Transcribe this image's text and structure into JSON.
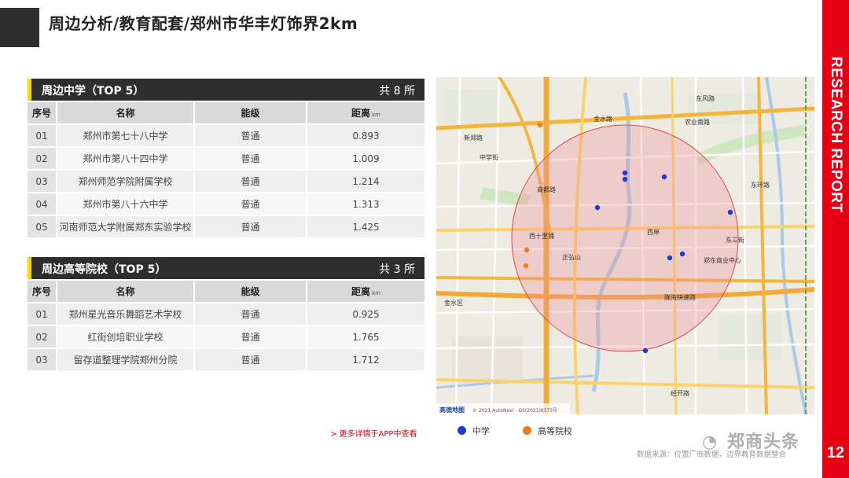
{
  "page": {
    "title": "周边分析/教育配套/郑州市华丰灯饰界2km",
    "side_text": "RESEARCH REPORT",
    "page_number": "12"
  },
  "middle_school": {
    "title": "周边中学（TOP 5）",
    "count": "共 8 所",
    "columns": [
      "序号",
      "名称",
      "能级",
      "距离"
    ],
    "unit": "km",
    "rows": [
      {
        "no": "01",
        "name": "郑州市第七十八中学",
        "level": "普通",
        "distance": "0.893"
      },
      {
        "no": "02",
        "name": "郑州市第八十四中学",
        "level": "普通",
        "distance": "1.009"
      },
      {
        "no": "03",
        "name": "郑州师范学院附属学校",
        "level": "普通",
        "distance": "1.214"
      },
      {
        "no": "04",
        "name": "郑州市第八十六中学",
        "level": "普通",
        "distance": "1.313"
      },
      {
        "no": "05",
        "name": "河南师范大学附属郑东实验学校",
        "level": "普通",
        "distance": "1.425"
      }
    ]
  },
  "college": {
    "title": "周边高等院校（TOP 5）",
    "count": "共 3 所",
    "columns": [
      "序号",
      "名称",
      "能级",
      "距离"
    ],
    "unit": "km",
    "rows": [
      {
        "no": "01",
        "name": "郑州星光音乐舞蹈艺术学校",
        "level": "普通",
        "distance": "0.925"
      },
      {
        "no": "02",
        "name": "红街创培职业学校",
        "level": "普通",
        "distance": "1.765"
      },
      {
        "no": "03",
        "name": "留存道整理学院郑州分院",
        "level": "普通",
        "distance": "1.712"
      }
    ]
  },
  "map": {
    "labels": {
      "l1": "金水路",
      "l2": "东风路",
      "l3": "农业南路",
      "l4": "商都路",
      "l5": "陇海快速路",
      "l6": "西十里铺",
      "l7": "正弘山",
      "l8": "郑东商业中心",
      "l9": "西单",
      "l10": "东三街",
      "l11": "东环路",
      "l12": "新郑路",
      "l13": "中学街",
      "l14": "金水区",
      "l15": "经开路",
      "l16": "高德地图",
      "l17": "© 2021 AutoNavi - GS(2021)6375号"
    },
    "colors": {
      "middle_school": "#1d3cd6",
      "college": "#f07a1a",
      "radius": "#d94a4a"
    }
  },
  "legend": {
    "middle_school": "中学",
    "college": "高等院校"
  },
  "more_link": "> 更多详情于APP中查看",
  "source": "数据来源：位置厂商数据，边界教育数据整合",
  "watermark": "郑商头条"
}
